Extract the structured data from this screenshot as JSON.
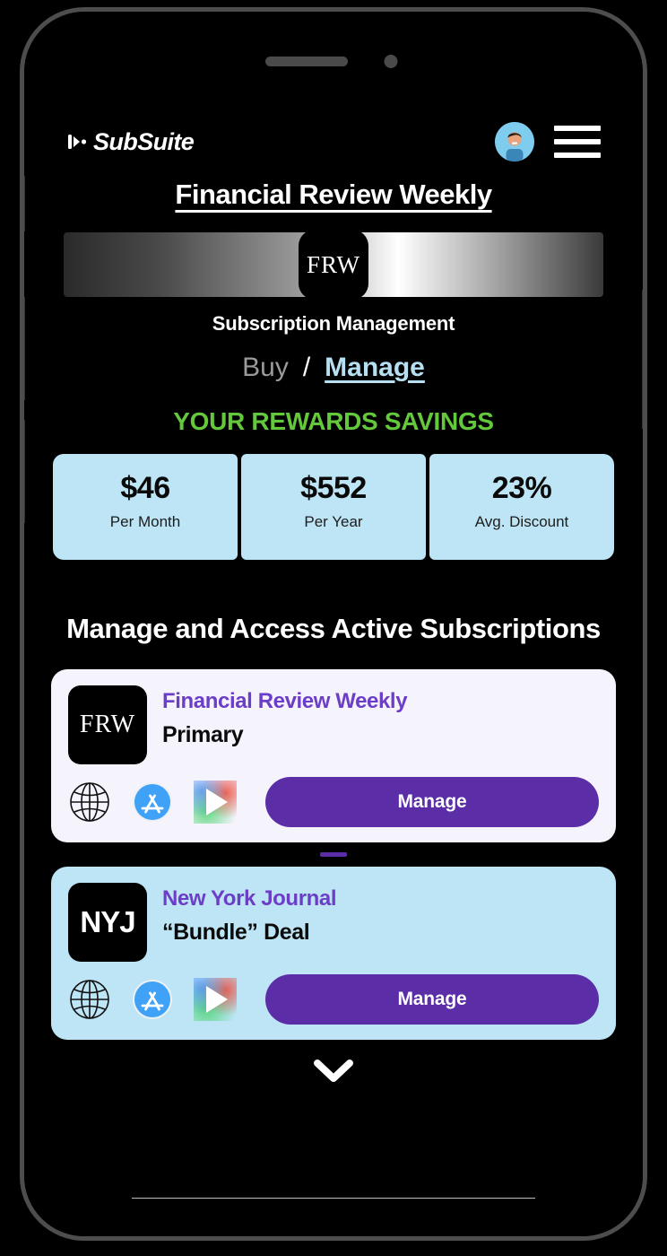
{
  "app": {
    "logo_text": "SubSuite",
    "logo_icon": "subsuite-mark-icon",
    "avatar_icon": "user-avatar-icon",
    "menu_icon": "hamburger-menu-icon"
  },
  "page": {
    "title": "Financial Review Weekly",
    "banner_badge": "FRW",
    "banner_subtitle": "Subscription Management"
  },
  "segmented": {
    "buy_label": "Buy",
    "separator": "/",
    "manage_label": "Manage"
  },
  "rewards": {
    "heading": "YOUR REWARDS SAVINGS",
    "stats": [
      {
        "value": "$46",
        "label": "Per Month"
      },
      {
        "value": "$552",
        "label": "Per Year"
      },
      {
        "value": "23%",
        "label": "Avg. Discount"
      }
    ]
  },
  "subscriptions": {
    "heading": "Manage and Access Active Subscriptions",
    "items": [
      {
        "logo": "FRW",
        "name": "Financial Review Weekly",
        "plan": "Primary",
        "manage_label": "Manage",
        "store_icons": [
          "globe-icon",
          "app-store-icon",
          "google-play-icon"
        ]
      },
      {
        "logo": "NYJ",
        "name": "New York Journal",
        "plan": "“Bundle” Deal",
        "manage_label": "Manage",
        "store_icons": [
          "globe-icon",
          "app-store-icon",
          "google-play-icon"
        ]
      }
    ]
  },
  "footer": {
    "scroll_icon": "chevron-down-icon"
  },
  "colors": {
    "background": "#000000",
    "accent_purple": "#5b2ea8",
    "title_purple": "#6c3ec8",
    "light_blue": "#bde5f5",
    "link_blue": "#b6dff2",
    "green": "#64c83c",
    "card_lavender": "#f5f3fc"
  }
}
